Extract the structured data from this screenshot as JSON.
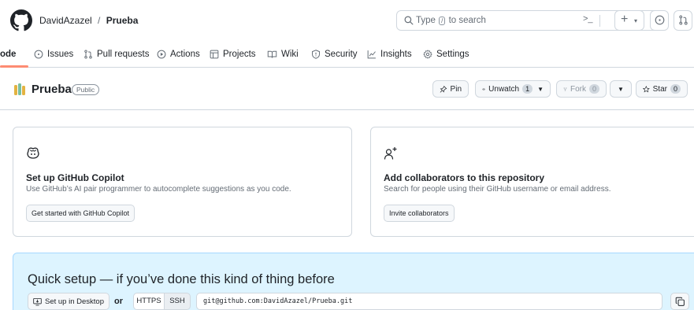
{
  "topbar": {
    "owner": "DavidAzazel",
    "separator": "/",
    "repo": "Prueba",
    "search_prefix": "Type",
    "search_key": "/",
    "search_suffix": "to search",
    "command_label": ">_",
    "plus_label": "+"
  },
  "nav": {
    "items": [
      {
        "label": "ode",
        "icon": "code-icon"
      },
      {
        "label": "Issues",
        "icon": "issue-icon"
      },
      {
        "label": "Pull requests",
        "icon": "pull-request-icon"
      },
      {
        "label": "Actions",
        "icon": "play-icon"
      },
      {
        "label": "Projects",
        "icon": "table-icon"
      },
      {
        "label": "Wiki",
        "icon": "book-icon"
      },
      {
        "label": "Security",
        "icon": "shield-icon"
      },
      {
        "label": "Insights",
        "icon": "graph-icon"
      },
      {
        "label": "Settings",
        "icon": "gear-icon"
      }
    ],
    "active": "ode"
  },
  "repo_header": {
    "name": "Prueba",
    "visibility": "Public",
    "pin_label": "Pin",
    "watch_label": "Unwatch",
    "watch_count": "1",
    "fork_label": "Fork",
    "fork_count": "0",
    "star_label": "Star",
    "star_count": "0"
  },
  "cards": [
    {
      "icon": "copilot-icon",
      "title": "Set up GitHub Copilot",
      "description": "Use GitHub’s AI pair programmer to autocomplete suggestions as you code.",
      "button": "Get started with GitHub Copilot"
    },
    {
      "icon": "person-add-icon",
      "title": "Add collaborators to this repository",
      "description": "Search for people using their GitHub username or email address.",
      "button": "Invite collaborators"
    }
  ],
  "quick_setup": {
    "title": "Quick setup — if you’ve done this kind of thing before",
    "desktop_button": "Set up in Desktop",
    "or_label": "or",
    "https_label": "HTTPS",
    "ssh_label": "SSH",
    "clone_url": "git@github.com:DavidAzazel/Prueba.git"
  },
  "colors": {
    "accent_underline": "#fd8c73",
    "quick_setup_bg": "#ddf4ff",
    "border": "#d0d7de",
    "muted_text": "#656d76"
  }
}
